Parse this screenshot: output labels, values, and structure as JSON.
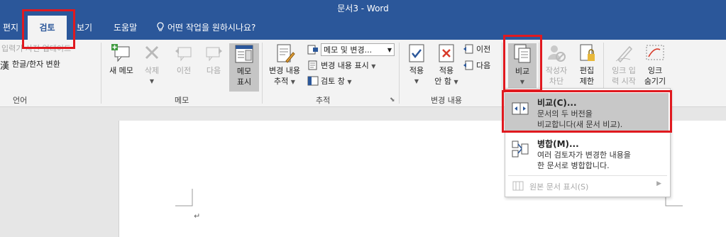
{
  "window": {
    "title": "문서3  -  Word"
  },
  "tabs": [
    {
      "label": "편지"
    },
    {
      "label": "검토"
    },
    {
      "label": "보기"
    },
    {
      "label": "도움말"
    }
  ],
  "tell_me": "어떤 작업을 원하시나요?",
  "ribbon": {
    "language": {
      "update_input": "입력기 사전 업데이트",
      "hanja": "한글/한자 변환",
      "group_label": "언어"
    },
    "memo": {
      "new": "새 메모",
      "delete": "삭제",
      "prev": "이전",
      "next": "다음",
      "show_line1": "메모",
      "show_line2": "표시",
      "group_label": "메모"
    },
    "tracking": {
      "track_line1": "변경 내용",
      "track_line2": "추적",
      "markup_dropdown": "메모 및 변경...",
      "show_markup": "변경 내용 표시",
      "review_pane": "검토 창",
      "group_label": "추적"
    },
    "changes": {
      "accept_line1": "적용",
      "reject_line1": "적용",
      "reject_line2": "안 함",
      "prev": "이전",
      "next": "다음",
      "group_label": "변경 내용"
    },
    "compare": {
      "label": "비교"
    },
    "protect": {
      "block_line1": "작성자",
      "block_line2": "차단",
      "restrict_line1": "편집",
      "restrict_line2": "제한"
    },
    "ink": {
      "start_line1": "잉크 입",
      "start_line2": "력 시작",
      "hide_line1": "잉크",
      "hide_line2": "숨기기"
    }
  },
  "compare_menu": {
    "compare": {
      "title": "비교(C)...",
      "desc_line1": "문서의 두 버전을",
      "desc_line2": "비교합니다(새 문서 비교)."
    },
    "combine": {
      "title": "병합(M)...",
      "desc_line1": "여러 검토자가 변경한 내용을",
      "desc_line2": "한 문서로 병합합니다."
    },
    "show_source": "원본 문서 표시(S)"
  },
  "document": {
    "paragraph_mark": "↵"
  },
  "colors": {
    "accent": "#2b579a",
    "highlight": "#e0191f"
  }
}
